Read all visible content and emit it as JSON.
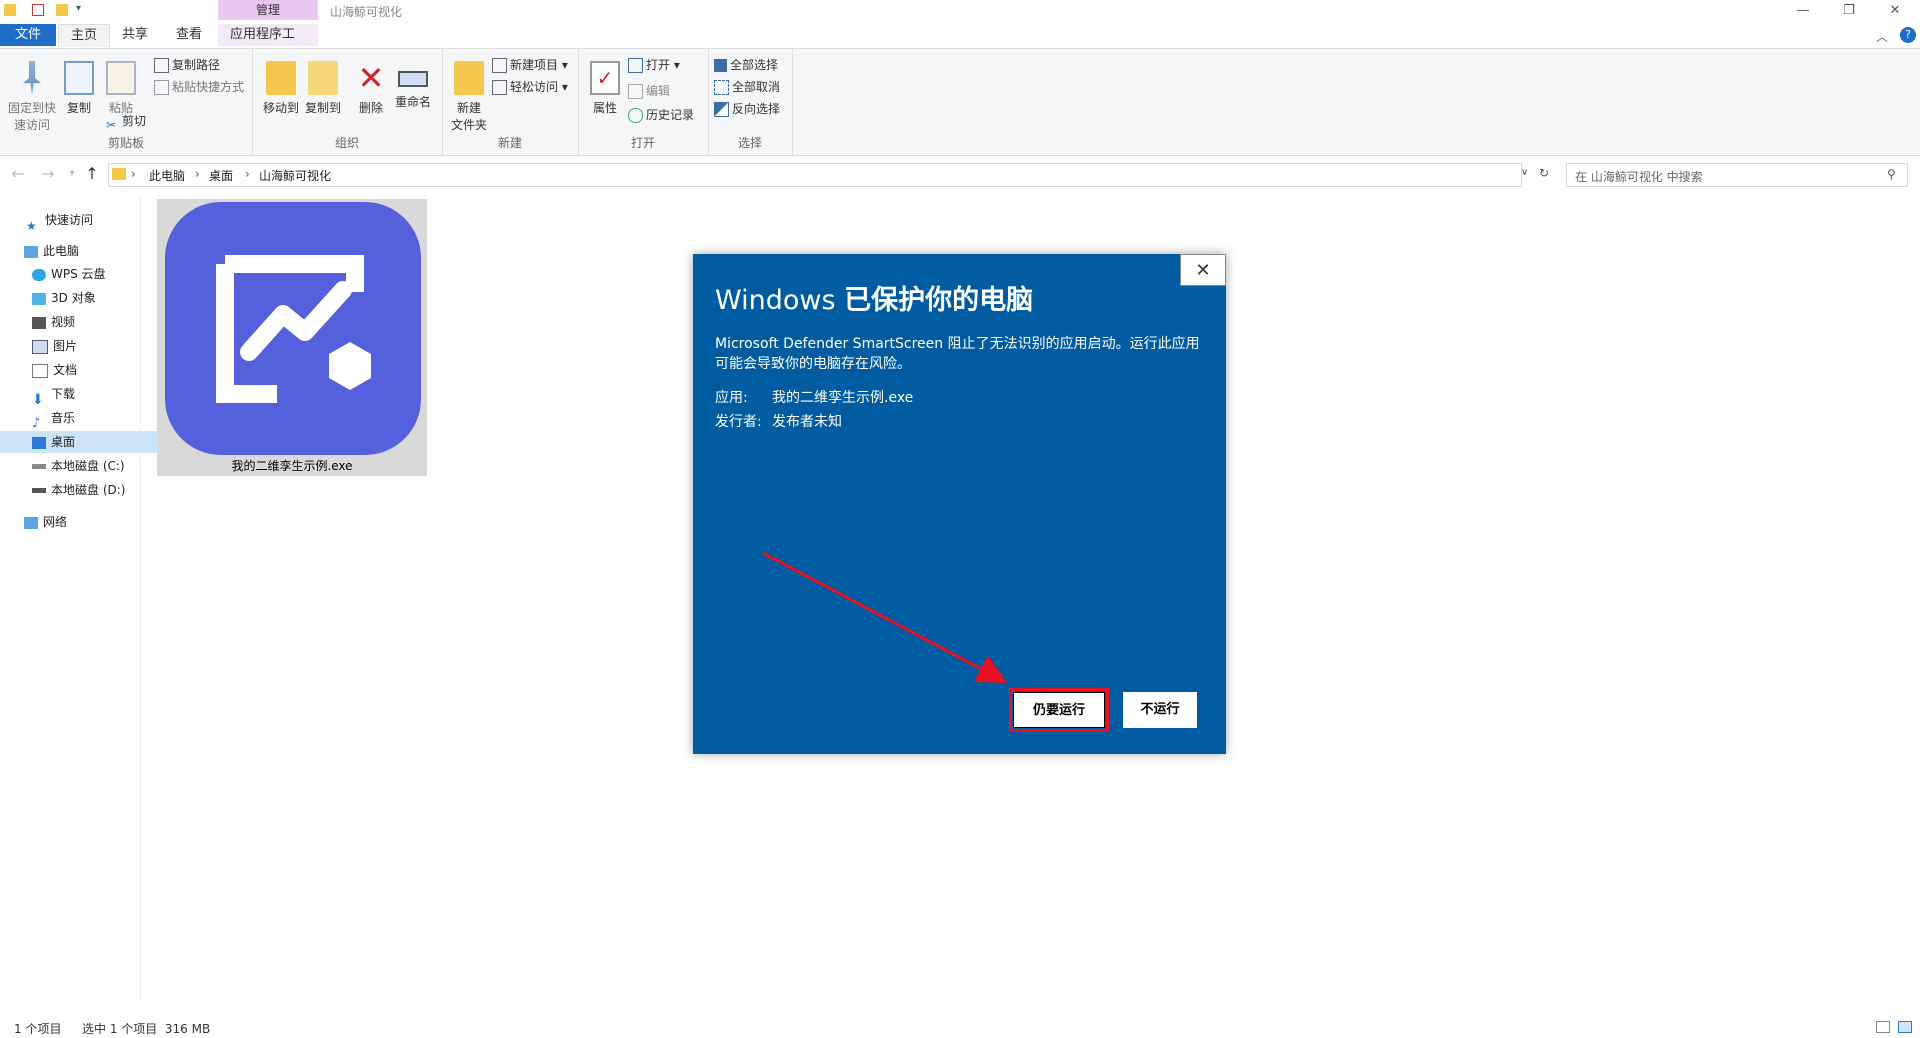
{
  "window": {
    "title": "山海鲸可视化",
    "context_tab_header": "管理",
    "minimize": "—",
    "maximize": "❐",
    "close": "✕"
  },
  "tabs": {
    "file": "文件",
    "home": "主页",
    "share": "共享",
    "view": "查看",
    "app_tools": "应用程序工具"
  },
  "ribbon": {
    "clipboard": {
      "label": "剪贴板",
      "pin": "固定到快\n速访问",
      "copy": "复制",
      "paste": "粘贴",
      "copy_path": "复制路径",
      "paste_shortcut": "粘贴快捷方式",
      "cut": "剪切"
    },
    "organize": {
      "label": "组织",
      "move_to": "移动到",
      "copy_to": "复制到",
      "delete": "删除",
      "rename": "重命名"
    },
    "new": {
      "label": "新建",
      "new_folder": "新建\n文件夹",
      "new_item": "新建项目 ▾",
      "easy_access": "轻松访问 ▾"
    },
    "open": {
      "label": "打开",
      "properties": "属性",
      "open": "打开 ▾",
      "edit": "编辑",
      "history": "历史记录"
    },
    "select": {
      "label": "选择",
      "select_all": "全部选择",
      "select_none": "全部取消",
      "invert": "反向选择"
    }
  },
  "address": {
    "crumbs": [
      "此电脑",
      "桌面",
      "山海鲸可视化"
    ],
    "search_placeholder": "在 山海鲸可视化 中搜索"
  },
  "sidebar": {
    "items": [
      {
        "label": "快速访问"
      },
      {
        "label": "此电脑"
      },
      {
        "label": "WPS 云盘"
      },
      {
        "label": "3D 对象"
      },
      {
        "label": "视频"
      },
      {
        "label": "图片"
      },
      {
        "label": "文档"
      },
      {
        "label": "下载"
      },
      {
        "label": "音乐"
      },
      {
        "label": "桌面"
      },
      {
        "label": "本地磁盘 (C:)"
      },
      {
        "label": "本地磁盘 (D:)"
      },
      {
        "label": "网络"
      }
    ]
  },
  "content": {
    "file_name": "我的二维孪生示例.exe"
  },
  "status": {
    "count": "1 个项目",
    "selected": "选中 1 个项目  316 MB"
  },
  "dialog": {
    "title_prefix": "Windows ",
    "title_bold": "已保护你的电脑",
    "body": "Microsoft Defender SmartScreen 阻止了无法识别的应用启动。运行此应用可能会导致你的电脑存在风险。",
    "app_label": "应用:",
    "app_value": "我的二维孪生示例.exe",
    "publisher_label": "发行者:",
    "publisher_value": "发布者未知",
    "run_anyway": "仍要运行",
    "dont_run": "不运行",
    "close": "✕"
  },
  "colors": {
    "dialog_bg": "#005ba1",
    "highlight": "#e81123",
    "file_tab": "#1e6ec8",
    "app_icon": "#5561dc"
  }
}
